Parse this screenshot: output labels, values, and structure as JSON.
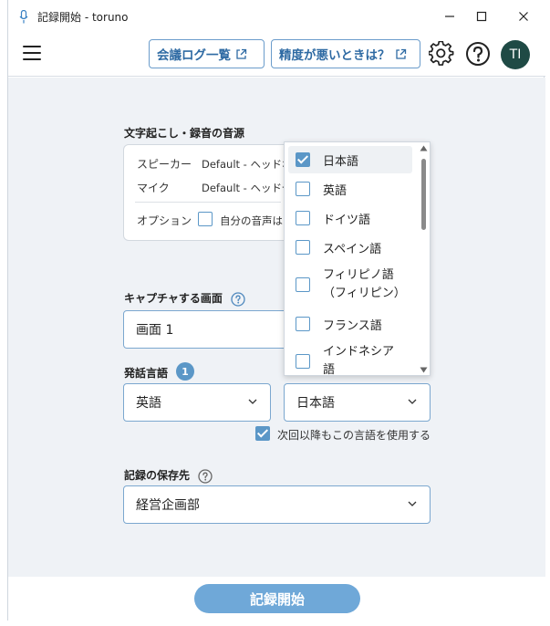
{
  "window": {
    "title": "記録開始 - toruno",
    "minimize": "─",
    "maximize": "☐",
    "close": "✕"
  },
  "toolbar": {
    "meeting_log_label": "会議ログ一覧",
    "accuracy_help_label": "精度が悪いときは？",
    "avatar_initials": "TI"
  },
  "audio_source": {
    "label": "文字起こし・録音の音源",
    "speaker_label": "スピーカー",
    "speaker_value": "Default - ヘッドホ",
    "mic_label": "マイク",
    "mic_value": "Default - ヘッドセ",
    "option_label": "オプション",
    "option_text": "自分の音声は"
  },
  "capture": {
    "label": "キャプチャする画面",
    "value": "画面 1"
  },
  "languages": {
    "label": "発話言語",
    "badge": "1",
    "primary_value": "英語",
    "secondary_value": "日本語",
    "remember_label": "次回以降もこの言語を使用する",
    "remember_checked": true,
    "options": [
      {
        "label": "日本語",
        "checked": true
      },
      {
        "label": "英語",
        "checked": false
      },
      {
        "label": "ドイツ語",
        "checked": false
      },
      {
        "label": "スペイン語",
        "checked": false
      },
      {
        "label": "フィリピノ語",
        "label2": "（フィリピン）",
        "checked": false
      },
      {
        "label": "フランス語",
        "checked": false
      },
      {
        "label": "インドネシア",
        "label2": "語",
        "checked": false
      }
    ]
  },
  "save_location": {
    "label": "記録の保存先",
    "value": "経営企画部"
  },
  "footer": {
    "start_label": "記録開始"
  }
}
